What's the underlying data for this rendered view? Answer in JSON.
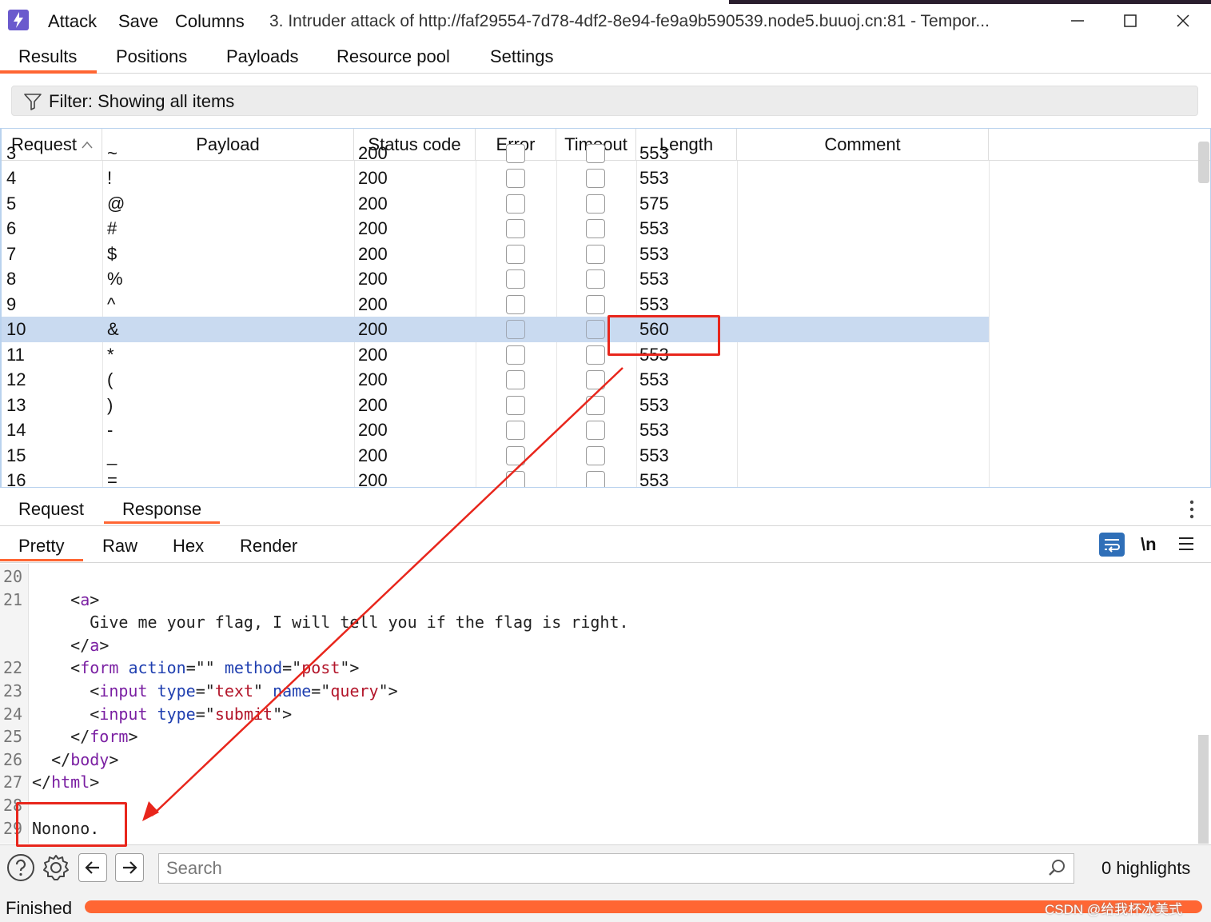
{
  "titlebar": {
    "menus": [
      "Attack",
      "Save",
      "Columns"
    ],
    "window_title": "3. Intruder attack of http://faf29554-7d78-4df2-8e94-fe9a9b590539.node5.buuoj.cn:81 - Tempor..."
  },
  "main_tabs": [
    "Results",
    "Positions",
    "Payloads",
    "Resource pool",
    "Settings"
  ],
  "active_main_tab": "Results",
  "filter": {
    "label": "Filter: Showing all items"
  },
  "table": {
    "columns": [
      "Request",
      "Payload",
      "Status code",
      "Error",
      "Timeout",
      "Length",
      "Comment"
    ],
    "sort_column": "Request",
    "rows": [
      {
        "request": "3",
        "payload": "~",
        "status": "200",
        "length": "553"
      },
      {
        "request": "4",
        "payload": "!",
        "status": "200",
        "length": "553"
      },
      {
        "request": "5",
        "payload": "@",
        "status": "200",
        "length": "575"
      },
      {
        "request": "6",
        "payload": "#",
        "status": "200",
        "length": "553"
      },
      {
        "request": "7",
        "payload": "$",
        "status": "200",
        "length": "553"
      },
      {
        "request": "8",
        "payload": "%",
        "status": "200",
        "length": "553"
      },
      {
        "request": "9",
        "payload": "^",
        "status": "200",
        "length": "553"
      },
      {
        "request": "10",
        "payload": "&",
        "status": "200",
        "length": "560"
      },
      {
        "request": "11",
        "payload": "*",
        "status": "200",
        "length": "553"
      },
      {
        "request": "12",
        "payload": "(",
        "status": "200",
        "length": "553"
      },
      {
        "request": "13",
        "payload": ")",
        "status": "200",
        "length": "553"
      },
      {
        "request": "14",
        "payload": "-",
        "status": "200",
        "length": "553"
      },
      {
        "request": "15",
        "payload": "_",
        "status": "200",
        "length": "553"
      },
      {
        "request": "16",
        "payload": "=",
        "status": "200",
        "length": "553"
      }
    ],
    "selected_request": "10"
  },
  "sub_tabs": [
    "Request",
    "Response"
  ],
  "active_sub_tab": "Response",
  "view_tabs": [
    "Pretty",
    "Raw",
    "Hex",
    "Render"
  ],
  "active_view_tab": "Pretty",
  "view_tools": {
    "newline_label": "\\n"
  },
  "code_lines": [
    {
      "n": "20",
      "tokens": []
    },
    {
      "n": "21",
      "tokens": [
        {
          "t": "    "
        },
        {
          "t": "<",
          "c": "p"
        },
        {
          "t": "a",
          "c": "tag"
        },
        {
          "t": ">",
          "c": "p"
        }
      ]
    },
    {
      "n": "",
      "tokens": [
        {
          "t": "      Give me your flag, I will tell you if the flag is right."
        }
      ]
    },
    {
      "n": "",
      "tokens": [
        {
          "t": "    "
        },
        {
          "t": "</",
          "c": "p"
        },
        {
          "t": "a",
          "c": "tag"
        },
        {
          "t": ">",
          "c": "p"
        }
      ]
    },
    {
      "n": "22",
      "tokens": [
        {
          "t": "    "
        },
        {
          "t": "<",
          "c": "p"
        },
        {
          "t": "form",
          "c": "tag"
        },
        {
          "t": " "
        },
        {
          "t": "action",
          "c": "attr"
        },
        {
          "t": "=\"\" "
        },
        {
          "t": "method",
          "c": "attr"
        },
        {
          "t": "=\""
        },
        {
          "t": "post",
          "c": "str"
        },
        {
          "t": "\">"
        }
      ]
    },
    {
      "n": "23",
      "tokens": [
        {
          "t": "      "
        },
        {
          "t": "<",
          "c": "p"
        },
        {
          "t": "input",
          "c": "tag"
        },
        {
          "t": " "
        },
        {
          "t": "type",
          "c": "attr"
        },
        {
          "t": "=\""
        },
        {
          "t": "text",
          "c": "str"
        },
        {
          "t": "\" "
        },
        {
          "t": "name",
          "c": "attr"
        },
        {
          "t": "=\""
        },
        {
          "t": "query",
          "c": "str"
        },
        {
          "t": "\">"
        }
      ]
    },
    {
      "n": "24",
      "tokens": [
        {
          "t": "      "
        },
        {
          "t": "<",
          "c": "p"
        },
        {
          "t": "input",
          "c": "tag"
        },
        {
          "t": " "
        },
        {
          "t": "type",
          "c": "attr"
        },
        {
          "t": "=\""
        },
        {
          "t": "submit",
          "c": "str"
        },
        {
          "t": "\">"
        }
      ]
    },
    {
      "n": "25",
      "tokens": [
        {
          "t": "    "
        },
        {
          "t": "</",
          "c": "p"
        },
        {
          "t": "form",
          "c": "tag"
        },
        {
          "t": ">",
          "c": "p"
        }
      ]
    },
    {
      "n": "26",
      "tokens": [
        {
          "t": "  "
        },
        {
          "t": "</",
          "c": "p"
        },
        {
          "t": "body",
          "c": "tag"
        },
        {
          "t": ">",
          "c": "p"
        }
      ]
    },
    {
      "n": "27",
      "tokens": [
        {
          "t": "</",
          "c": "p"
        },
        {
          "t": "html",
          "c": "tag"
        },
        {
          "t": ">",
          "c": "p"
        }
      ]
    },
    {
      "n": "28",
      "tokens": []
    },
    {
      "n": "29",
      "tokens": [
        {
          "t": "Nonono."
        }
      ]
    }
  ],
  "search": {
    "placeholder": "Search",
    "highlights": "0 highlights"
  },
  "status": {
    "text": "Finished",
    "progress": 1.0
  },
  "watermark": "CSDN @给我杯冰美式",
  "colors": {
    "accent": "#ff6633",
    "selected_row": "#c9daf0",
    "annotation": "#e8261c",
    "tag": "#7a1fa2",
    "attr": "#1f3fb0",
    "string": "#b3162b"
  },
  "icons": [
    "burp-logo-icon",
    "filter-icon",
    "sort-ascending-icon",
    "more-vertical-icon",
    "wrap-lines-icon",
    "menu-icon",
    "help-icon",
    "gear-icon",
    "arrow-left-icon",
    "arrow-right-icon",
    "search-icon",
    "minimize-icon",
    "maximize-icon",
    "close-icon"
  ]
}
